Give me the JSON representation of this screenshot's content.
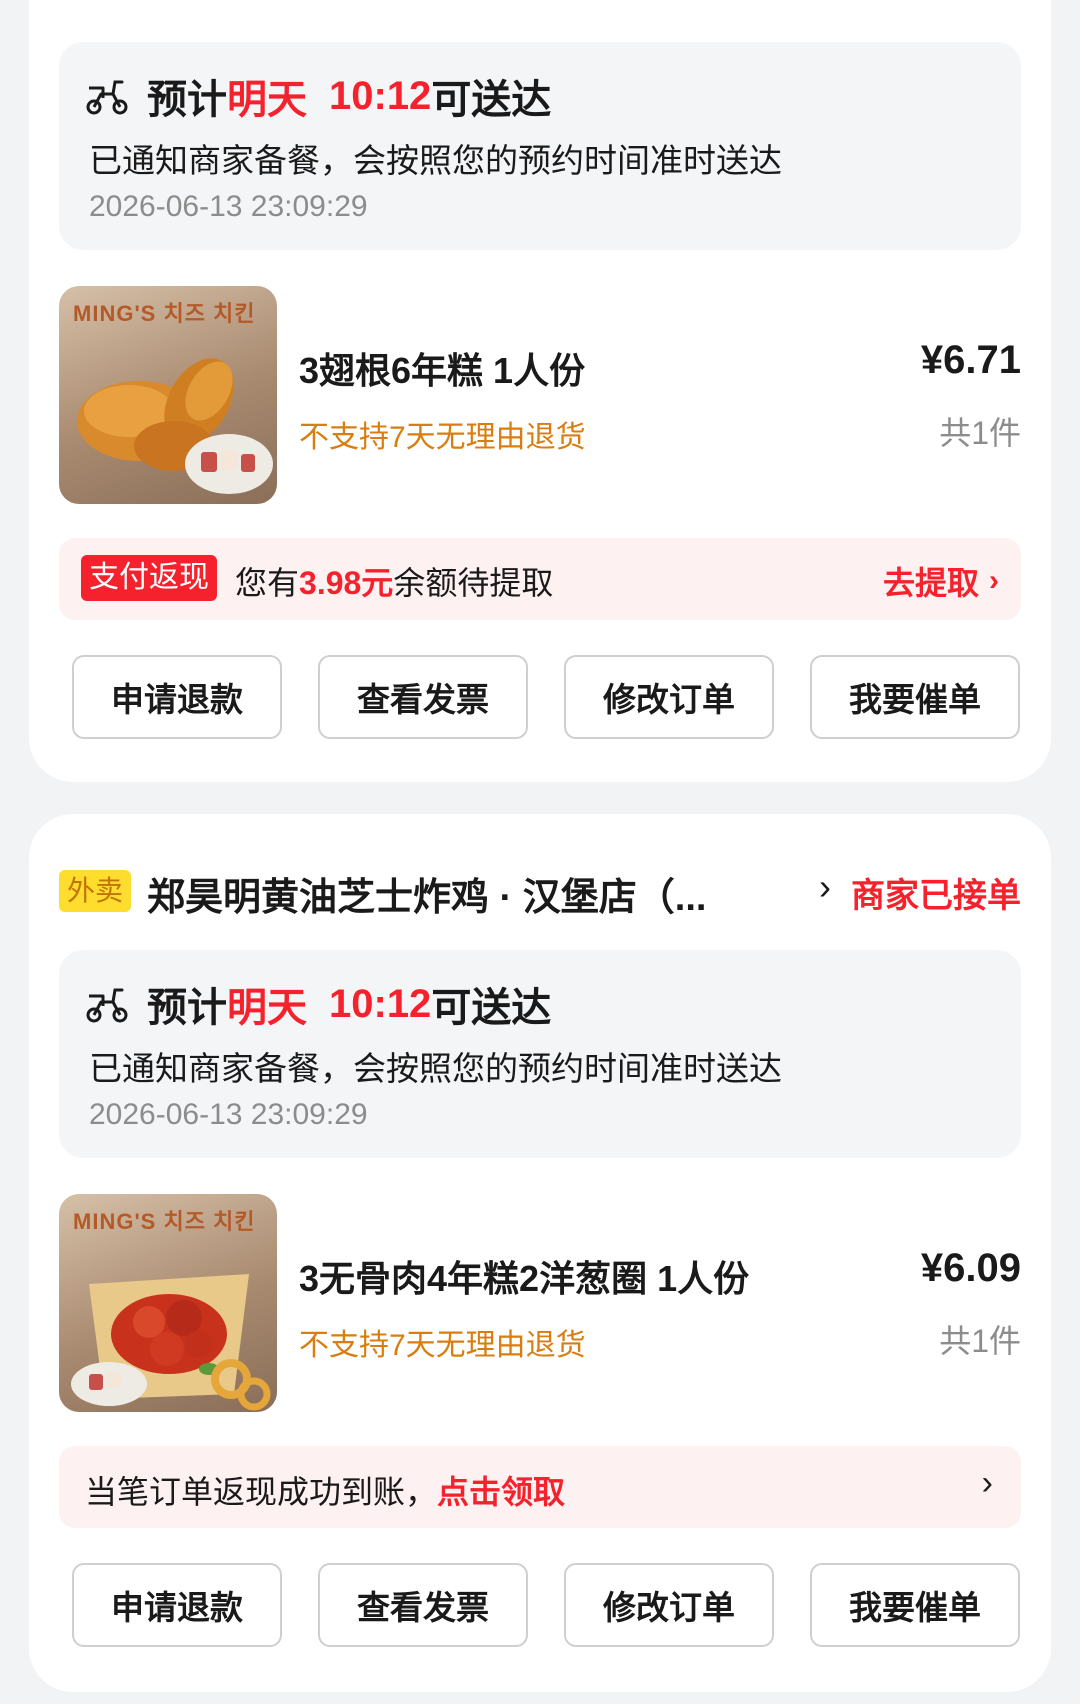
{
  "orders": [
    {
      "delivery": {
        "prefix": "预计",
        "day": "明天",
        "time": "10:12",
        "suffix": "可送达",
        "notice": "已通知商家备餐，会按照您的预约时间准时送达",
        "timestamp": "2026-06-13  23:09:29"
      },
      "item": {
        "image_brand": "MING'S 치즈 치킨",
        "name": "3翅根6年糕  1人份",
        "note": "不支持7天无理由退货",
        "price": "¥6.71",
        "qty": "共1件"
      },
      "promo": {
        "tag": "支付返现",
        "text_prefix": "您有",
        "amount": "3.98元",
        "text_suffix": "余额待提取",
        "link": "去提取"
      },
      "buttons": [
        "申请退款",
        "查看发票",
        "修改订单",
        "我要催单"
      ]
    },
    {
      "store": {
        "tag": "外卖",
        "name": "郑昊明黄油芝士炸鸡 · 汉堡店（...",
        "status": "商家已接单"
      },
      "delivery": {
        "prefix": "预计",
        "day": "明天",
        "time": "10:12",
        "suffix": "可送达",
        "notice": "已通知商家备餐，会按照您的预约时间准时送达",
        "timestamp": "2026-06-13  23:09:29"
      },
      "item": {
        "image_brand": "MING'S 치즈 치킨",
        "name": "3无骨肉4年糕2洋葱圈  1人份",
        "note": "不支持7天无理由退货",
        "price": "¥6.09",
        "qty": "共1件"
      },
      "promo": {
        "text": "当笔订单返现成功到账，",
        "link": "点击领取"
      },
      "buttons": [
        "申请退款",
        "查看发票",
        "修改订单",
        "我要催单"
      ]
    }
  ],
  "colors": {
    "accent_red": "#f5222d",
    "note_orange": "#d97d10",
    "takeout_tag_yellow": "#ffdd2e"
  },
  "icons": [
    "scooter-icon",
    "chevron-right-icon"
  ]
}
